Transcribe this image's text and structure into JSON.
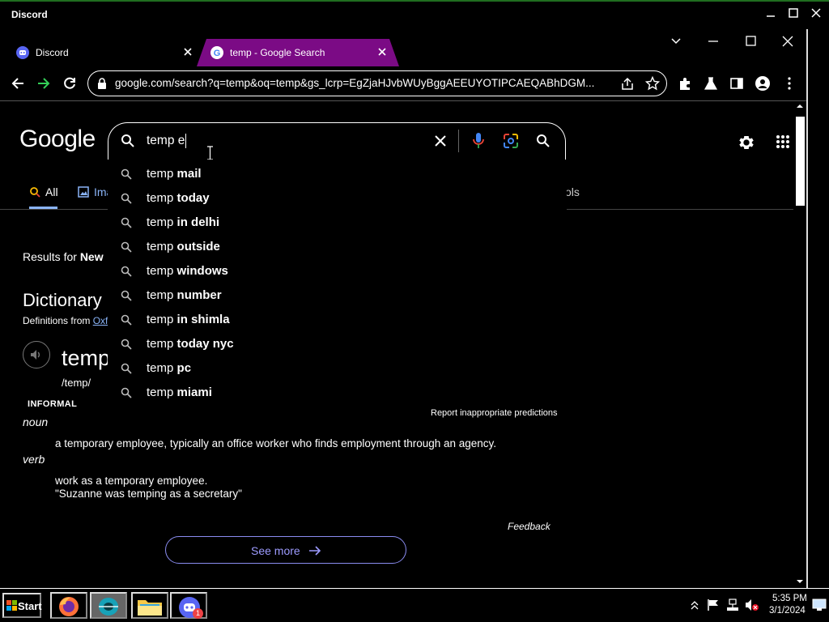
{
  "outer_window": {
    "title": "Discord"
  },
  "tabs": [
    {
      "label": "Discord",
      "active": false
    },
    {
      "label": "temp - Google Search",
      "active": true
    }
  ],
  "omnibox": {
    "url": "google.com/search?q=temp&oq=temp&gs_lcrp=EgZjaHJvbWUyBggAEEUYOTIPCAEQABhDGM..."
  },
  "google": {
    "logo": "Google",
    "search_value": "temp e",
    "suggestions": [
      {
        "prefix": "temp",
        "bold": "mail"
      },
      {
        "prefix": "temp",
        "bold": "today"
      },
      {
        "prefix": "temp",
        "bold": "in delhi"
      },
      {
        "prefix": "temp",
        "bold": "outside"
      },
      {
        "prefix": "temp",
        "bold": "windows"
      },
      {
        "prefix": "temp",
        "bold": "number"
      },
      {
        "prefix": "temp",
        "bold": "in shimla"
      },
      {
        "prefix": "temp",
        "bold": "today nyc"
      },
      {
        "prefix": "temp",
        "bold": "pc"
      },
      {
        "prefix": "temp",
        "bold": "miami"
      }
    ],
    "report_link": "Report inappropriate predictions",
    "tabs": {
      "all": "All",
      "images": "Ima",
      "tools": "ols"
    },
    "results_for_prefix": "Results for ",
    "results_for_place": "New ",
    "dictionary": {
      "heading": "Dictionary",
      "definitions_from": "Definitions from ",
      "source": "Oxf",
      "word": "temp",
      "phonetic": "/temp/",
      "label_informal": "INFORMAL",
      "pos_noun": "noun",
      "def_noun": "a temporary employee, typically an office worker who finds employment through an agency.",
      "pos_verb": "verb",
      "def_verb": "work as a temporary employee.",
      "example_verb": "\"Suzanne was temping as a secretary\"",
      "feedback": "Feedback",
      "see_more": "See more"
    }
  },
  "taskbar": {
    "start": "Start",
    "time": "5:35 PM",
    "date": "3/1/2024",
    "discord_badge": "1"
  },
  "colors": {
    "active_tab": "#7b0b85",
    "link": "#8ab4f8",
    "see_more": "#9d9bff",
    "mic_blue": "#4285f4",
    "mic_red": "#ea4335"
  }
}
